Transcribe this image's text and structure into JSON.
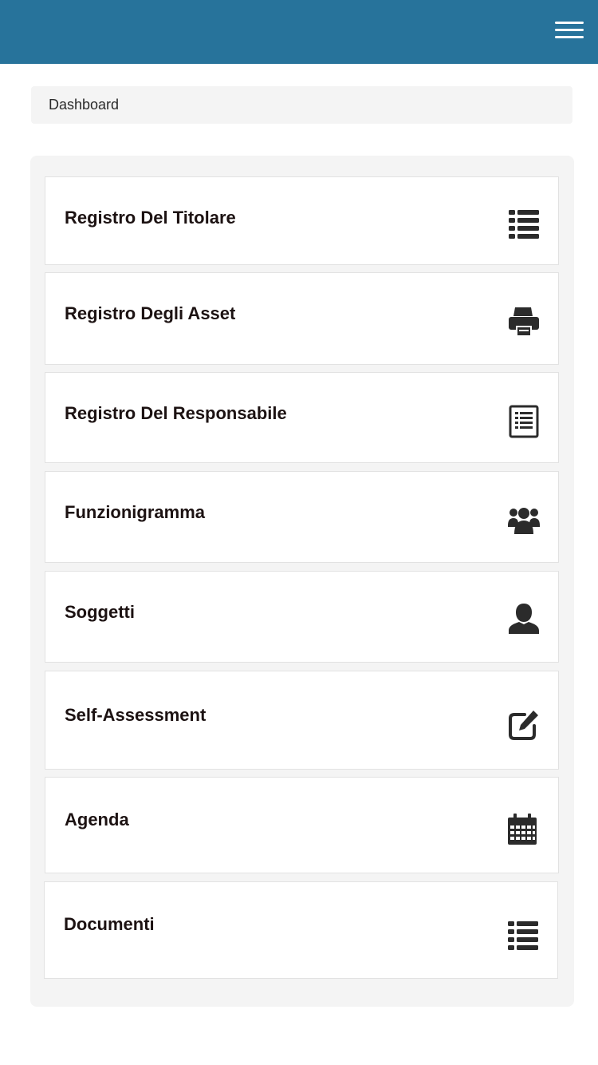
{
  "header": {
    "menu_icon": "hamburger-menu-icon",
    "background_color": "#27739b"
  },
  "breadcrumb": {
    "label": "Dashboard"
  },
  "menu": {
    "items": [
      {
        "label": "Registro Del Titolare",
        "icon": "list-icon"
      },
      {
        "label": "Registro Degli Asset",
        "icon": "printer-icon"
      },
      {
        "label": "Registro Del Responsabile",
        "icon": "document-list-icon"
      },
      {
        "label": "Funzionigramma",
        "icon": "users-group-icon"
      },
      {
        "label": "Soggetti",
        "icon": "user-icon"
      },
      {
        "label": "Self-Assessment",
        "icon": "edit-square-icon"
      },
      {
        "label": "Agenda",
        "icon": "calendar-icon"
      },
      {
        "label": "Documenti",
        "icon": "list-icon"
      }
    ]
  }
}
